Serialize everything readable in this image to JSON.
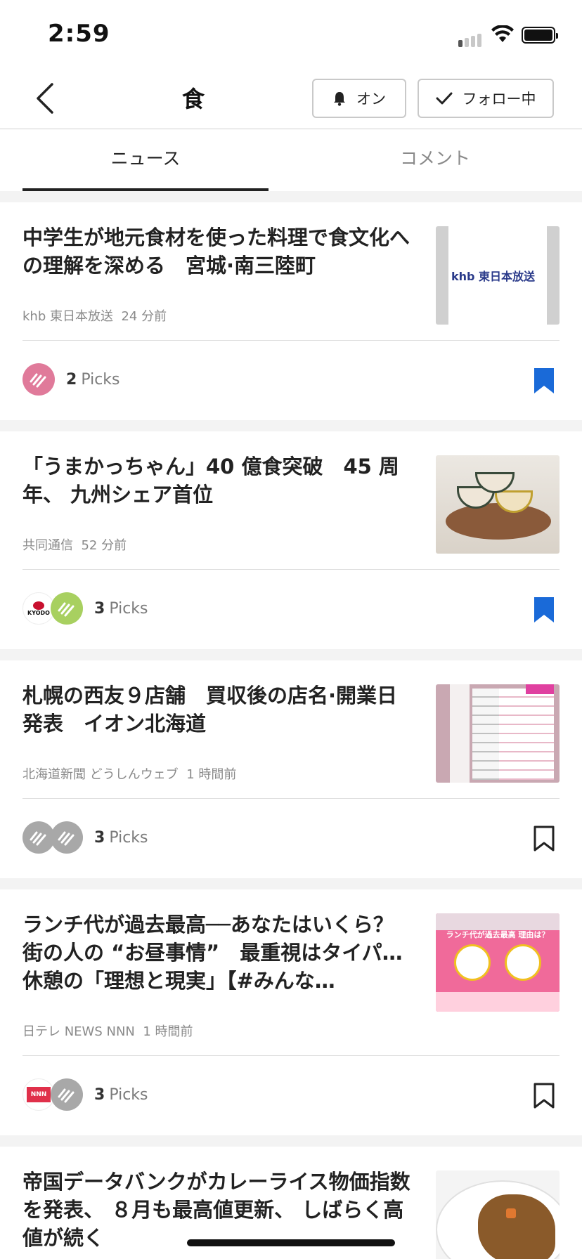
{
  "status": {
    "time": "2:59"
  },
  "nav": {
    "title": "食",
    "notify_label": "オン",
    "follow_label": "フォロー中"
  },
  "tabs": [
    {
      "label": "ニュース",
      "active": true
    },
    {
      "label": "コメント",
      "active": false
    }
  ],
  "colors": {
    "accent": "#1a6ad8",
    "text": "#222222",
    "muted": "#8a8a8a"
  },
  "articles": [
    {
      "title": "中学生が地元食材を使った料理で食文化への理解を深める　宮城·南三陸町",
      "source": "khb 東日本放送",
      "time": "24 分前",
      "thumb_text": "khb 東日本放送",
      "picks_count": "2",
      "picks_label": "Picks",
      "bookmarked": true
    },
    {
      "title": "「うまかっちゃん」40 億食突破　45 周年、 九州シェア首位",
      "source": "共同通信",
      "time": "52 分前",
      "avatar_text": "KYODO",
      "picks_count": "3",
      "picks_label": "Picks",
      "bookmarked": true
    },
    {
      "title": "札幌の西友９店舗　買収後の店名·開業日発表　イオン北海道",
      "source": "北海道新聞 どうしんウェブ",
      "time": "1 時間前",
      "picks_count": "3",
      "picks_label": "Picks",
      "bookmarked": false
    },
    {
      "title": "ランチ代が過去最高──あなたはいくら？　街の人の “お昼事情”　最重視はタイパ…休憩の「理想と現実」【#みんな…",
      "source": "日テレ NEWS NNN",
      "time": "1 時間前",
      "avatar_text": "NNN",
      "thumb_text": "ランチ代が過去最高 理由は？",
      "picks_count": "3",
      "picks_label": "Picks",
      "bookmarked": false
    },
    {
      "title": "帝国データバンクがカレーライス物価指数を発表、 ８月も最高値更新、 しばらく高値が続く"
    }
  ]
}
